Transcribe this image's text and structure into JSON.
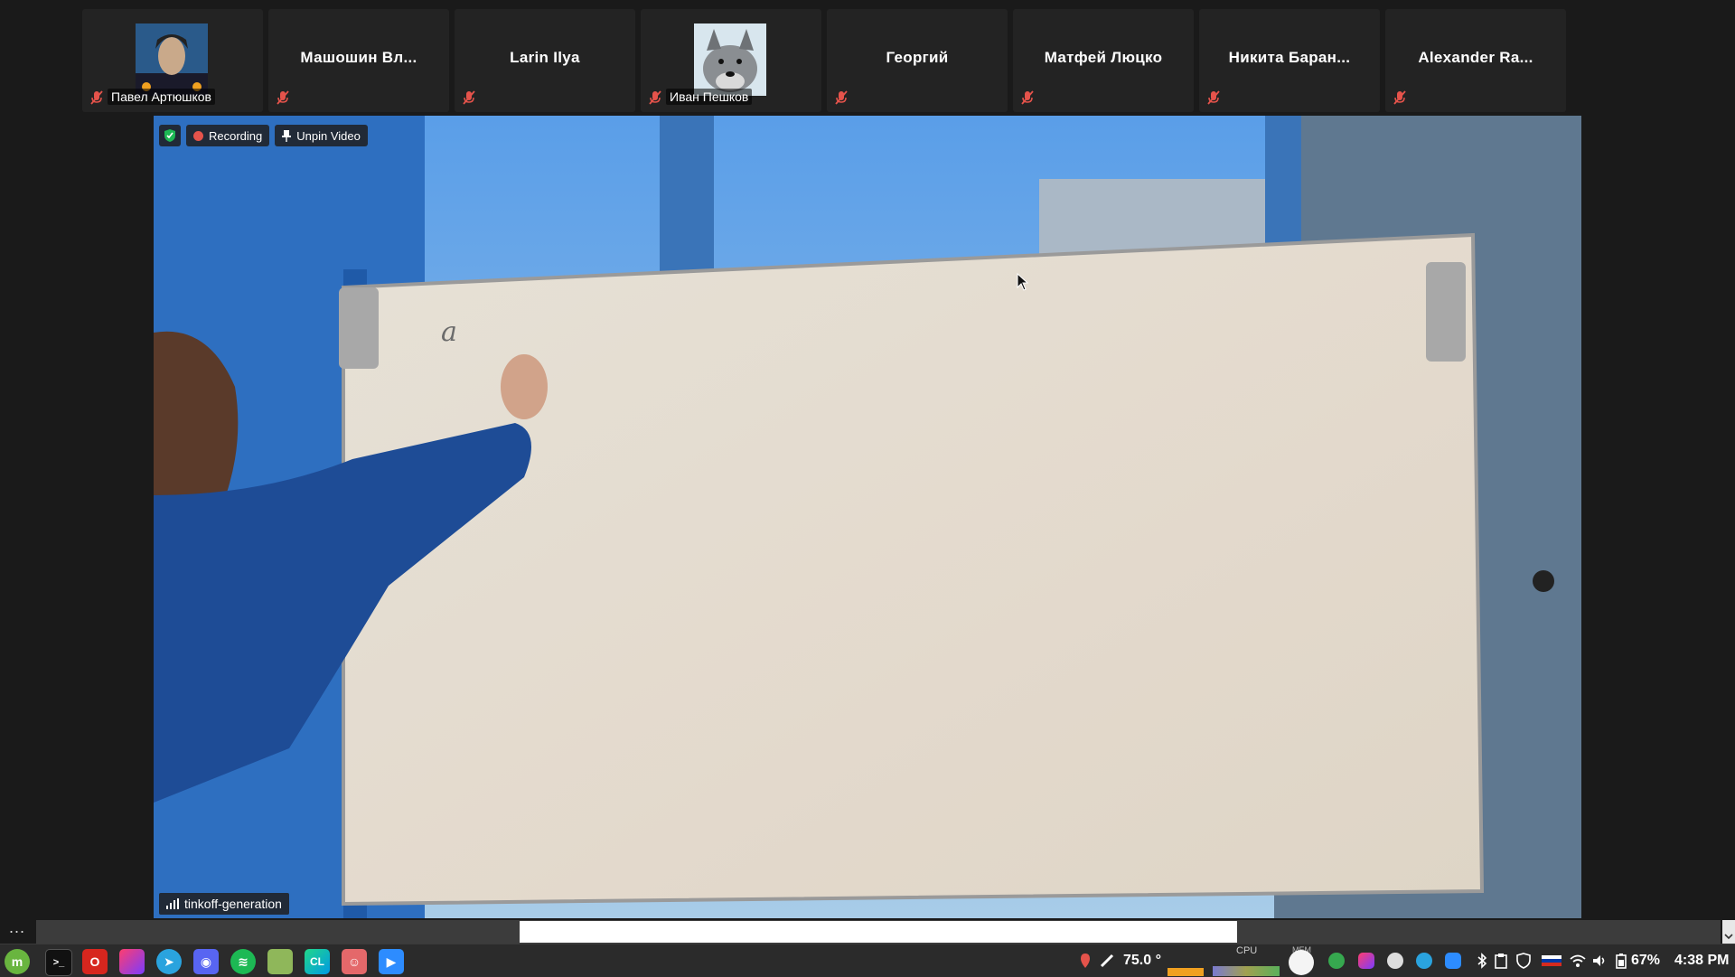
{
  "participants": [
    {
      "name": "Павел Артюшков",
      "has_avatar": true,
      "avatar": "illustrated-man"
    },
    {
      "name": "Машошин Вл...",
      "has_avatar": false
    },
    {
      "name": "Larin Ilya",
      "has_avatar": false
    },
    {
      "name": "Иван Пешков",
      "has_avatar": true,
      "avatar": "cartoon-wolf"
    },
    {
      "name": "Георгий",
      "has_avatar": false
    },
    {
      "name": "Матфей Люцко",
      "has_avatar": false
    },
    {
      "name": "Никита Баран...",
      "has_avatar": false
    },
    {
      "name": "Alexander Ra...",
      "has_avatar": false
    }
  ],
  "video": {
    "recording_label": "Recording",
    "unpin_label": "Unpin Video",
    "speaker_name": "tinkoff-generation",
    "whiteboard_text": "a",
    "colors": {
      "record": "#e5534b",
      "shield": "#1db954",
      "mic_muted": "#e5534b"
    }
  },
  "overflow": {
    "dots": "..."
  },
  "taskbar": {
    "apps": [
      "mint-menu-icon",
      "terminal-icon",
      "opera-icon",
      "jetbrains-toolbox-icon",
      "telegram-icon",
      "discord-icon",
      "spotify-icon",
      "files-icon",
      "clion-icon",
      "gitkraken-icon",
      "zoom-icon"
    ],
    "temperature": "75.0 °",
    "cpu_label": "CPU",
    "mem_label": "MEM",
    "battery": "67%",
    "time": "4:38 PM"
  }
}
